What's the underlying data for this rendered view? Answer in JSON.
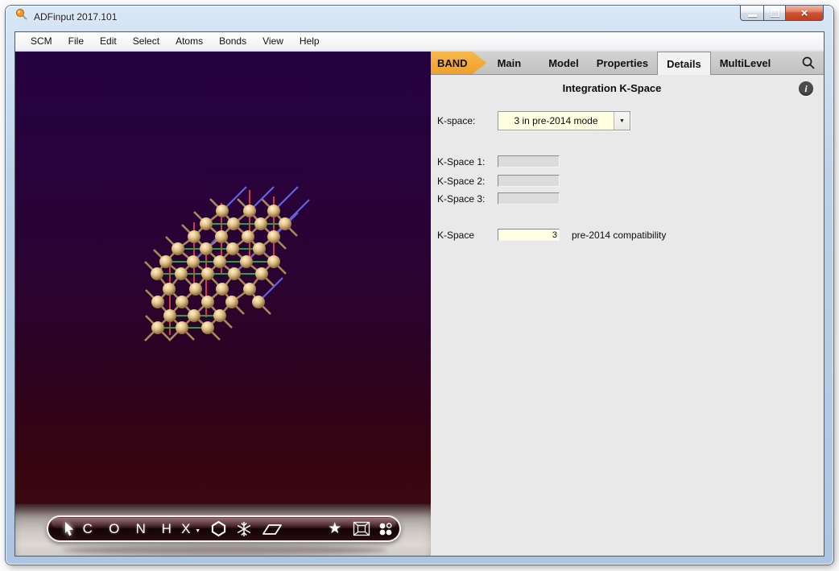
{
  "window": {
    "title": "ADFinput 2017.101"
  },
  "icons": {
    "close_glyph": "×",
    "caret_glyph": "▼"
  },
  "menu": {
    "items": [
      "SCM",
      "File",
      "Edit",
      "Select",
      "Atoms",
      "Bonds",
      "View",
      "Help"
    ]
  },
  "tabs": {
    "selected": "Details",
    "items": [
      {
        "label": "BAND"
      },
      {
        "label": "Main"
      },
      {
        "label": "Model"
      },
      {
        "label": "Properties"
      },
      {
        "label": "Details"
      },
      {
        "label": "MultiLevel"
      }
    ]
  },
  "panel": {
    "section_title": "Integration K-Space",
    "kspace_mode": {
      "label": "K-space:",
      "value": "3 in pre-2014 mode"
    },
    "fields": [
      {
        "label": "K-Space 1:",
        "value": ""
      },
      {
        "label": "K-Space 2:",
        "value": ""
      },
      {
        "label": "K-Space 3:",
        "value": ""
      }
    ],
    "compat": {
      "label": "K-Space",
      "value": "3",
      "note": "pre-2014 compatibility"
    },
    "info_glyph": "i"
  },
  "viewer_toolbar": {
    "items": [
      {
        "name": "select-tool",
        "icon": "cursor-arrow"
      },
      {
        "name": "element-carbon",
        "label": "C"
      },
      {
        "name": "element-oxygen",
        "label": "O"
      },
      {
        "name": "element-nitrogen",
        "label": "N"
      },
      {
        "name": "element-hydrogen",
        "label": "H"
      },
      {
        "name": "element-picker",
        "label": "X",
        "caret": "▼"
      },
      {
        "name": "ring-tool",
        "icon": "hexagon"
      },
      {
        "name": "crystal-tool",
        "icon": "snowflake"
      },
      {
        "name": "plane-tool",
        "icon": "parallelogram"
      },
      {
        "name": "favorites-tool",
        "icon": "star",
        "glyph": "★"
      },
      {
        "name": "periodic-box-tool",
        "icon": "wireframe-box"
      },
      {
        "name": "render-mode-tool",
        "icon": "spheres"
      }
    ]
  },
  "colors": {
    "band_tab": "#f2a732",
    "field_yellow": "#ffffe1",
    "viewer_top": "#250140",
    "viewer_bottom": "#3a0810",
    "info_badge": "#4c4c4c"
  }
}
